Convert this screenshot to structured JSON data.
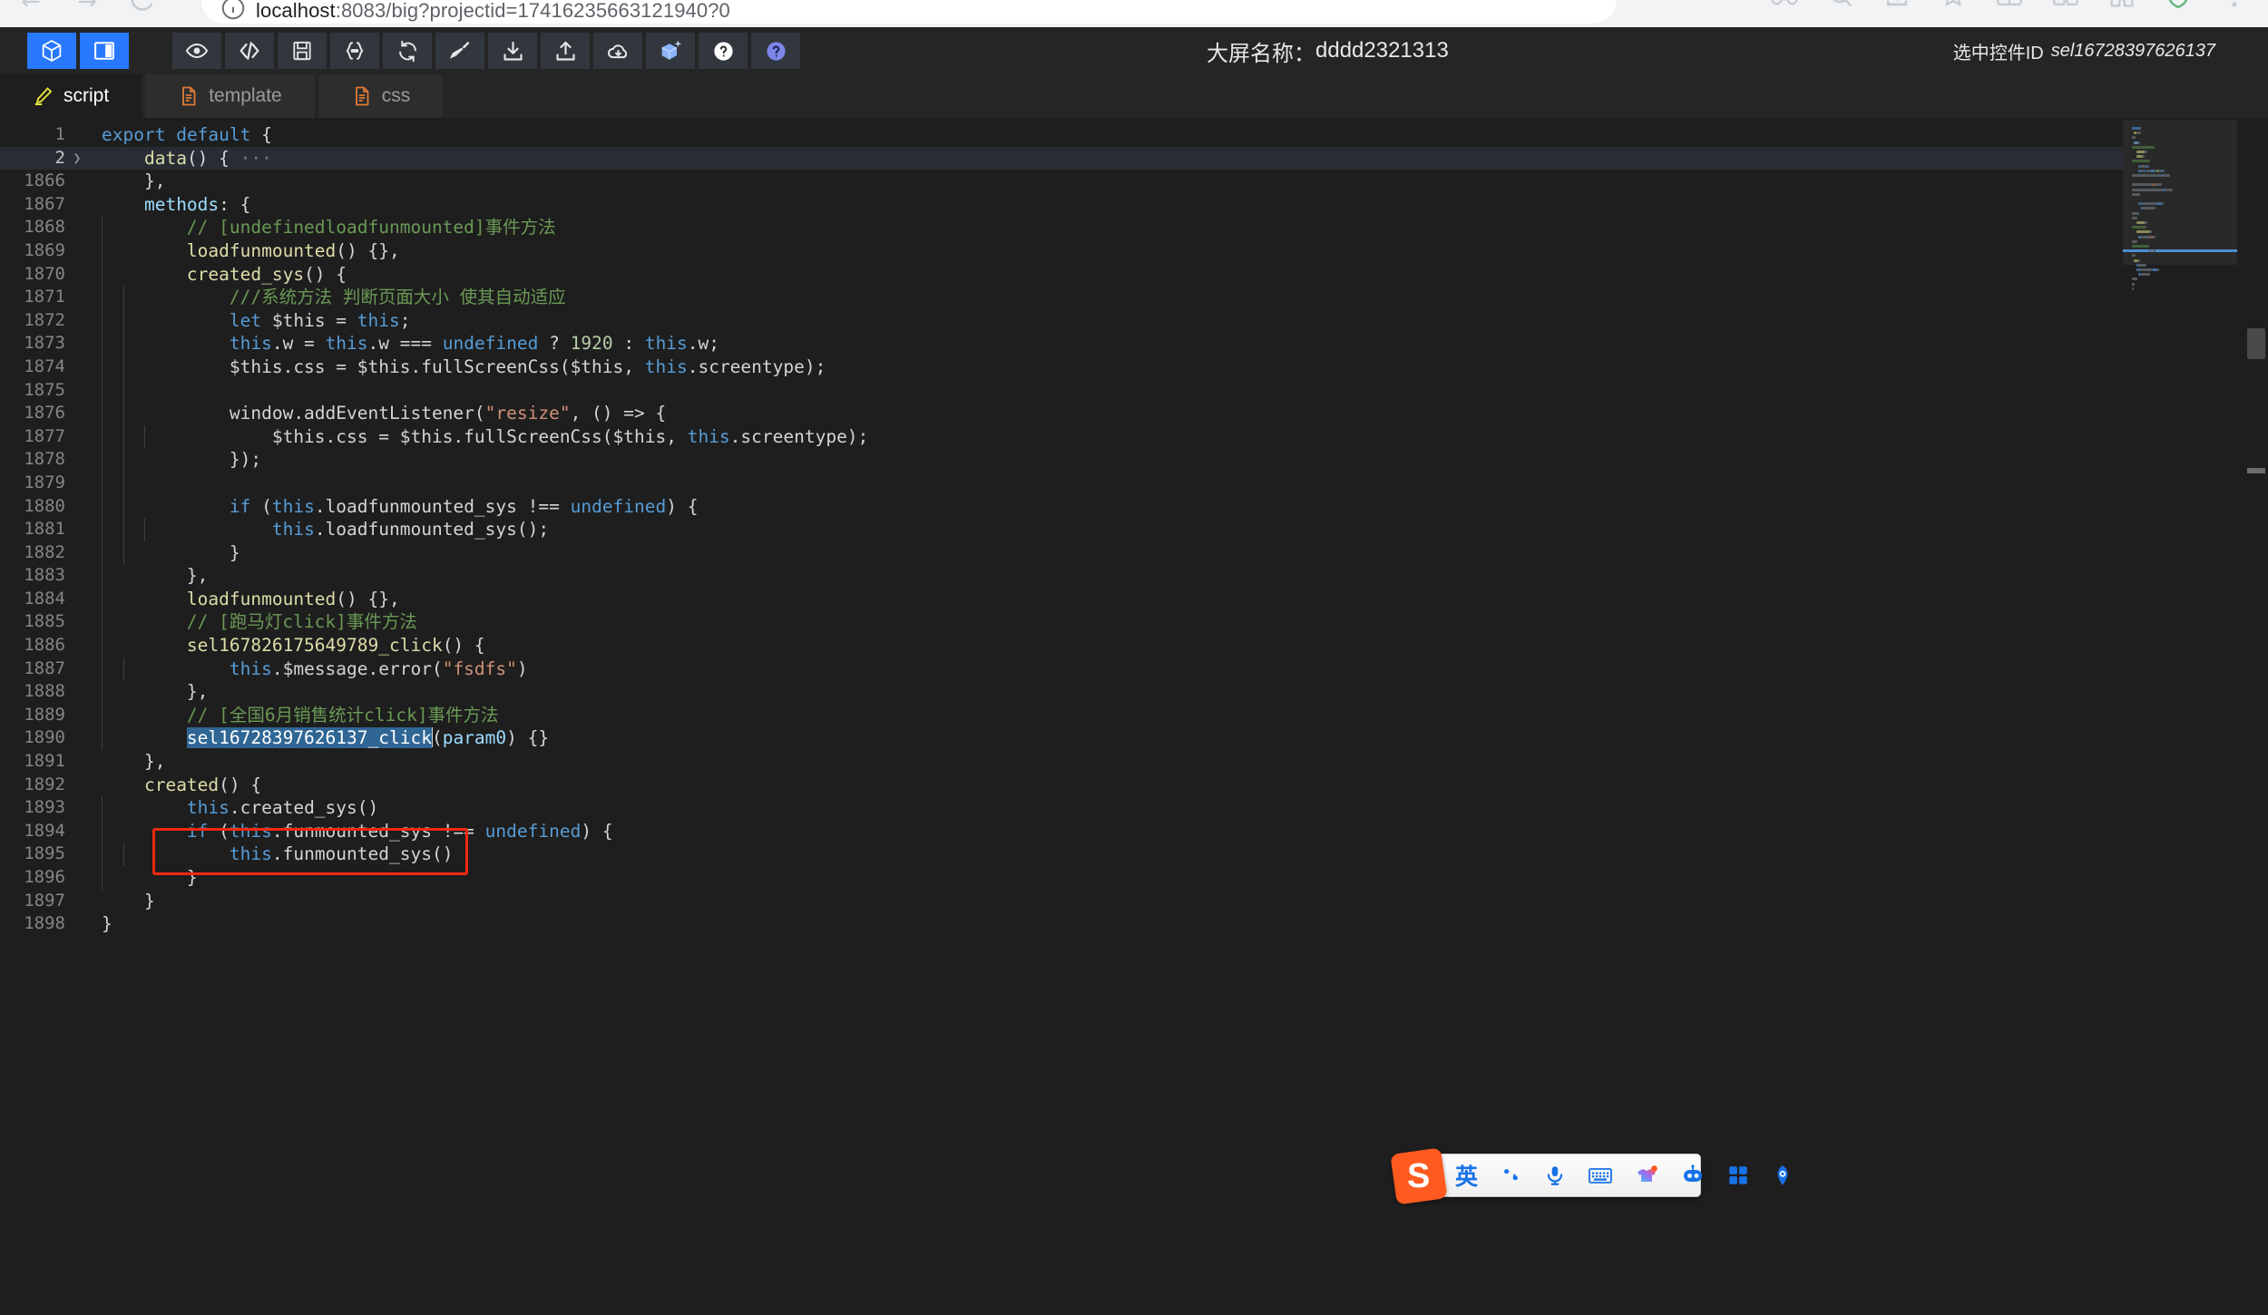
{
  "browser": {
    "url_host": "localhost",
    "url_rest": ":8083/big?projectid=17416235663121940?0",
    "back_glyph": "←",
    "forward_glyph": "→",
    "icons": [
      "reload-icon",
      "info-icon",
      "extensions-icon",
      "search-icon",
      "profile-icon",
      "bookmark-icon",
      "split-icon",
      "tabs-icon",
      "puzzle-icon",
      "shield-icon",
      "menu-icon"
    ]
  },
  "toolbar": {
    "mode_buttons": [
      {
        "name": "3d-cube-view-button",
        "icon": "cube-icon",
        "active": true
      },
      {
        "name": "panel-layout-button",
        "icon": "panel-layout-icon",
        "active": true
      }
    ],
    "tools": [
      {
        "name": "preview-button",
        "icon": "eye-icon"
      },
      {
        "name": "source-code-button",
        "icon": "code-brackets-icon"
      },
      {
        "name": "save-button",
        "icon": "floppy-disk-icon"
      },
      {
        "name": "format-json-button",
        "icon": "curly-braces-icon"
      },
      {
        "name": "refresh-button",
        "icon": "refresh-icon"
      },
      {
        "name": "clear-button",
        "icon": "broom-icon"
      },
      {
        "name": "import-button",
        "icon": "download-icon"
      },
      {
        "name": "export-button",
        "icon": "upload-icon"
      },
      {
        "name": "cloud-sync-button",
        "icon": "cloud-download-icon"
      },
      {
        "name": "add-component-button",
        "icon": "cube-plus-icon"
      },
      {
        "name": "help-button",
        "icon": "question-circle-icon"
      },
      {
        "name": "about-button",
        "icon": "question-circle-filled-icon"
      }
    ],
    "screen_name_label": "大屏名称：",
    "screen_name_value": "dddd2321313",
    "selected_widget_label": "选中控件ID",
    "selected_widget_id": "sel16728397626137"
  },
  "tabs": [
    {
      "label": "script",
      "icon": "pencil-icon",
      "active": true
    },
    {
      "label": "template",
      "icon": "file-icon",
      "active": false
    },
    {
      "label": "css",
      "icon": "file-icon",
      "active": false
    }
  ],
  "code": {
    "lines": [
      {
        "num": "1",
        "fold": "",
        "indent": 0,
        "current": false,
        "tokens": [
          {
            "t": "export",
            "c": "kw"
          },
          {
            "t": " ",
            "c": "pu"
          },
          {
            "t": "default",
            "c": "kw"
          },
          {
            "t": " {",
            "c": "pu"
          }
        ]
      },
      {
        "num": "2",
        "fold": "❯",
        "indent": 0,
        "current": true,
        "tokens": [
          {
            "t": "    ",
            "c": "pu"
          },
          {
            "t": "data",
            "c": "fn"
          },
          {
            "t": "() { ",
            "c": "pu"
          },
          {
            "t": "···",
            "c": "folded"
          }
        ]
      },
      {
        "num": "1866",
        "fold": "",
        "indent": 0,
        "current": false,
        "tokens": [
          {
            "t": "    },",
            "c": "pu"
          }
        ]
      },
      {
        "num": "1867",
        "fold": "",
        "indent": 0,
        "current": false,
        "tokens": [
          {
            "t": "    ",
            "c": "pu"
          },
          {
            "t": "methods",
            "c": "pl"
          },
          {
            "t": ": {",
            "c": "pu"
          }
        ]
      },
      {
        "num": "1868",
        "fold": "",
        "indent": 1,
        "current": false,
        "tokens": [
          {
            "t": "        // [undefinedloadfunmounted]事件方法",
            "c": "cmt"
          }
        ]
      },
      {
        "num": "1869",
        "fold": "",
        "indent": 1,
        "current": false,
        "tokens": [
          {
            "t": "        ",
            "c": "pu"
          },
          {
            "t": "loadfunmounted",
            "c": "fn"
          },
          {
            "t": "() {},",
            "c": "pu"
          }
        ]
      },
      {
        "num": "1870",
        "fold": "",
        "indent": 1,
        "current": false,
        "tokens": [
          {
            "t": "        ",
            "c": "pu"
          },
          {
            "t": "created_sys",
            "c": "fn"
          },
          {
            "t": "() {",
            "c": "pu"
          }
        ]
      },
      {
        "num": "1871",
        "fold": "",
        "indent": 2,
        "current": false,
        "tokens": [
          {
            "t": "            ///系统方法 判断页面大小 使其自动适应",
            "c": "cmt"
          }
        ]
      },
      {
        "num": "1872",
        "fold": "",
        "indent": 2,
        "current": false,
        "tokens": [
          {
            "t": "            ",
            "c": "pu"
          },
          {
            "t": "let",
            "c": "kw"
          },
          {
            "t": " $this = ",
            "c": "pu"
          },
          {
            "t": "this",
            "c": "kw"
          },
          {
            "t": ";",
            "c": "pu"
          }
        ]
      },
      {
        "num": "1873",
        "fold": "",
        "indent": 2,
        "current": false,
        "tokens": [
          {
            "t": "            ",
            "c": "pu"
          },
          {
            "t": "this",
            "c": "kw"
          },
          {
            "t": ".w = ",
            "c": "pu"
          },
          {
            "t": "this",
            "c": "kw"
          },
          {
            "t": ".w === ",
            "c": "pu"
          },
          {
            "t": "undefined",
            "c": "kw"
          },
          {
            "t": " ? ",
            "c": "pu"
          },
          {
            "t": "1920",
            "c": "num2"
          },
          {
            "t": " : ",
            "c": "pu"
          },
          {
            "t": "this",
            "c": "kw"
          },
          {
            "t": ".w;",
            "c": "pu"
          }
        ]
      },
      {
        "num": "1874",
        "fold": "",
        "indent": 2,
        "current": false,
        "tokens": [
          {
            "t": "            $this.css = $this.",
            "c": "pu"
          },
          {
            "t": "fullScreenCss",
            "c": "pu"
          },
          {
            "t": "($this, ",
            "c": "pu"
          },
          {
            "t": "this",
            "c": "kw"
          },
          {
            "t": ".screentype);",
            "c": "pu"
          }
        ]
      },
      {
        "num": "1875",
        "fold": "",
        "indent": 2,
        "current": false,
        "tokens": []
      },
      {
        "num": "1876",
        "fold": "",
        "indent": 2,
        "current": false,
        "tokens": [
          {
            "t": "            window.addEventListener(",
            "c": "pu"
          },
          {
            "t": "\"resize\"",
            "c": "str"
          },
          {
            "t": ", () => {",
            "c": "pu"
          }
        ]
      },
      {
        "num": "1877",
        "fold": "",
        "indent": 3,
        "current": false,
        "tokens": [
          {
            "t": "                $this.css = $this.fullScreenCss($this, ",
            "c": "pu"
          },
          {
            "t": "this",
            "c": "kw"
          },
          {
            "t": ".screentype);",
            "c": "pu"
          }
        ]
      },
      {
        "num": "1878",
        "fold": "",
        "indent": 2,
        "current": false,
        "tokens": [
          {
            "t": "            });",
            "c": "pu"
          }
        ]
      },
      {
        "num": "1879",
        "fold": "",
        "indent": 2,
        "current": false,
        "tokens": []
      },
      {
        "num": "1880",
        "fold": "",
        "indent": 2,
        "current": false,
        "tokens": [
          {
            "t": "            ",
            "c": "pu"
          },
          {
            "t": "if",
            "c": "kw"
          },
          {
            "t": " (",
            "c": "pu"
          },
          {
            "t": "this",
            "c": "kw"
          },
          {
            "t": ".loadfunmounted_sys !== ",
            "c": "pu"
          },
          {
            "t": "undefined",
            "c": "kw"
          },
          {
            "t": ") {",
            "c": "pu"
          }
        ]
      },
      {
        "num": "1881",
        "fold": "",
        "indent": 3,
        "current": false,
        "tokens": [
          {
            "t": "                ",
            "c": "pu"
          },
          {
            "t": "this",
            "c": "kw"
          },
          {
            "t": ".loadfunmounted_sys();",
            "c": "pu"
          }
        ]
      },
      {
        "num": "1882",
        "fold": "",
        "indent": 2,
        "current": false,
        "tokens": [
          {
            "t": "            }",
            "c": "pu"
          }
        ]
      },
      {
        "num": "1883",
        "fold": "",
        "indent": 1,
        "current": false,
        "tokens": [
          {
            "t": "        },",
            "c": "pu"
          }
        ]
      },
      {
        "num": "1884",
        "fold": "",
        "indent": 1,
        "current": false,
        "tokens": [
          {
            "t": "        ",
            "c": "pu"
          },
          {
            "t": "loadfunmounted",
            "c": "fn"
          },
          {
            "t": "() {},",
            "c": "pu"
          }
        ]
      },
      {
        "num": "1885",
        "fold": "",
        "indent": 1,
        "current": false,
        "tokens": [
          {
            "t": "        // [跑马灯click]事件方法",
            "c": "cmt"
          }
        ]
      },
      {
        "num": "1886",
        "fold": "",
        "indent": 1,
        "current": false,
        "tokens": [
          {
            "t": "        ",
            "c": "pu"
          },
          {
            "t": "sel167826175649789_click",
            "c": "fn"
          },
          {
            "t": "() {",
            "c": "pu"
          }
        ]
      },
      {
        "num": "1887",
        "fold": "",
        "indent": 2,
        "current": false,
        "tokens": [
          {
            "t": "            ",
            "c": "pu"
          },
          {
            "t": "this",
            "c": "kw"
          },
          {
            "t": ".$message.error(",
            "c": "pu"
          },
          {
            "t": "\"fsdfs\"",
            "c": "str"
          },
          {
            "t": ")",
            "c": "pu"
          }
        ]
      },
      {
        "num": "1888",
        "fold": "",
        "indent": 1,
        "current": false,
        "tokens": [
          {
            "t": "        },",
            "c": "pu"
          }
        ]
      },
      {
        "num": "1889",
        "fold": "",
        "indent": 1,
        "current": false,
        "tokens": [
          {
            "t": "        // [全国6月销售统计click]事件方法",
            "c": "cmt"
          }
        ]
      },
      {
        "num": "1890",
        "fold": "",
        "indent": 1,
        "current": false,
        "selected": true,
        "tokens": [
          {
            "t": "        ",
            "c": "pu"
          },
          {
            "t": "sel16728397626137_click",
            "c": "selhl"
          },
          {
            "t": "(",
            "c": "pu"
          },
          {
            "t": "param0",
            "c": "pl"
          },
          {
            "t": ") {}",
            "c": "pu"
          }
        ]
      },
      {
        "num": "1891",
        "fold": "",
        "indent": 0,
        "current": false,
        "tokens": [
          {
            "t": "    },",
            "c": "pu"
          }
        ]
      },
      {
        "num": "1892",
        "fold": "",
        "indent": 0,
        "current": false,
        "tokens": [
          {
            "t": "    ",
            "c": "pu"
          },
          {
            "t": "created",
            "c": "fn"
          },
          {
            "t": "() {",
            "c": "pu"
          }
        ]
      },
      {
        "num": "1893",
        "fold": "",
        "indent": 1,
        "current": false,
        "tokens": [
          {
            "t": "        ",
            "c": "pu"
          },
          {
            "t": "this",
            "c": "kw"
          },
          {
            "t": ".created_sys()",
            "c": "pu"
          }
        ]
      },
      {
        "num": "1894",
        "fold": "",
        "indent": 1,
        "current": false,
        "tokens": [
          {
            "t": "        ",
            "c": "pu"
          },
          {
            "t": "if",
            "c": "kw"
          },
          {
            "t": " (",
            "c": "pu"
          },
          {
            "t": "this",
            "c": "kw"
          },
          {
            "t": ".funmounted_sys !== ",
            "c": "pu"
          },
          {
            "t": "undefined",
            "c": "kw"
          },
          {
            "t": ") {",
            "c": "pu"
          }
        ]
      },
      {
        "num": "1895",
        "fold": "",
        "indent": 2,
        "current": false,
        "tokens": [
          {
            "t": "            ",
            "c": "pu"
          },
          {
            "t": "this",
            "c": "kw"
          },
          {
            "t": ".funmounted_sys()",
            "c": "pu"
          }
        ]
      },
      {
        "num": "1896",
        "fold": "",
        "indent": 1,
        "current": false,
        "tokens": [
          {
            "t": "        }",
            "c": "pu"
          }
        ]
      },
      {
        "num": "1897",
        "fold": "",
        "indent": 0,
        "current": false,
        "tokens": [
          {
            "t": "    }",
            "c": "pu"
          }
        ]
      },
      {
        "num": "1898",
        "fold": "",
        "indent": 0,
        "current": false,
        "tokens": [
          {
            "t": "}",
            "c": "pu"
          }
        ]
      }
    ],
    "annotation": {
      "name": "red-highlight-box",
      "color": "#f0290f"
    }
  },
  "ime": {
    "logo_text": "S",
    "items": [
      {
        "name": "ime-language-mode",
        "label": "英",
        "type": "text"
      },
      {
        "name": "ime-punctuation-toggle",
        "label": "",
        "type": "punct"
      },
      {
        "name": "ime-voice-input",
        "label": "",
        "type": "mic"
      },
      {
        "name": "ime-soft-keyboard",
        "label": "",
        "type": "keyboard"
      },
      {
        "name": "ime-skin",
        "label": "",
        "type": "skin"
      },
      {
        "name": "ime-ai-assistant",
        "label": "",
        "type": "robot"
      },
      {
        "name": "ime-toolbox",
        "label": "",
        "type": "grid"
      },
      {
        "name": "ime-settings",
        "label": "",
        "type": "settings"
      }
    ]
  }
}
